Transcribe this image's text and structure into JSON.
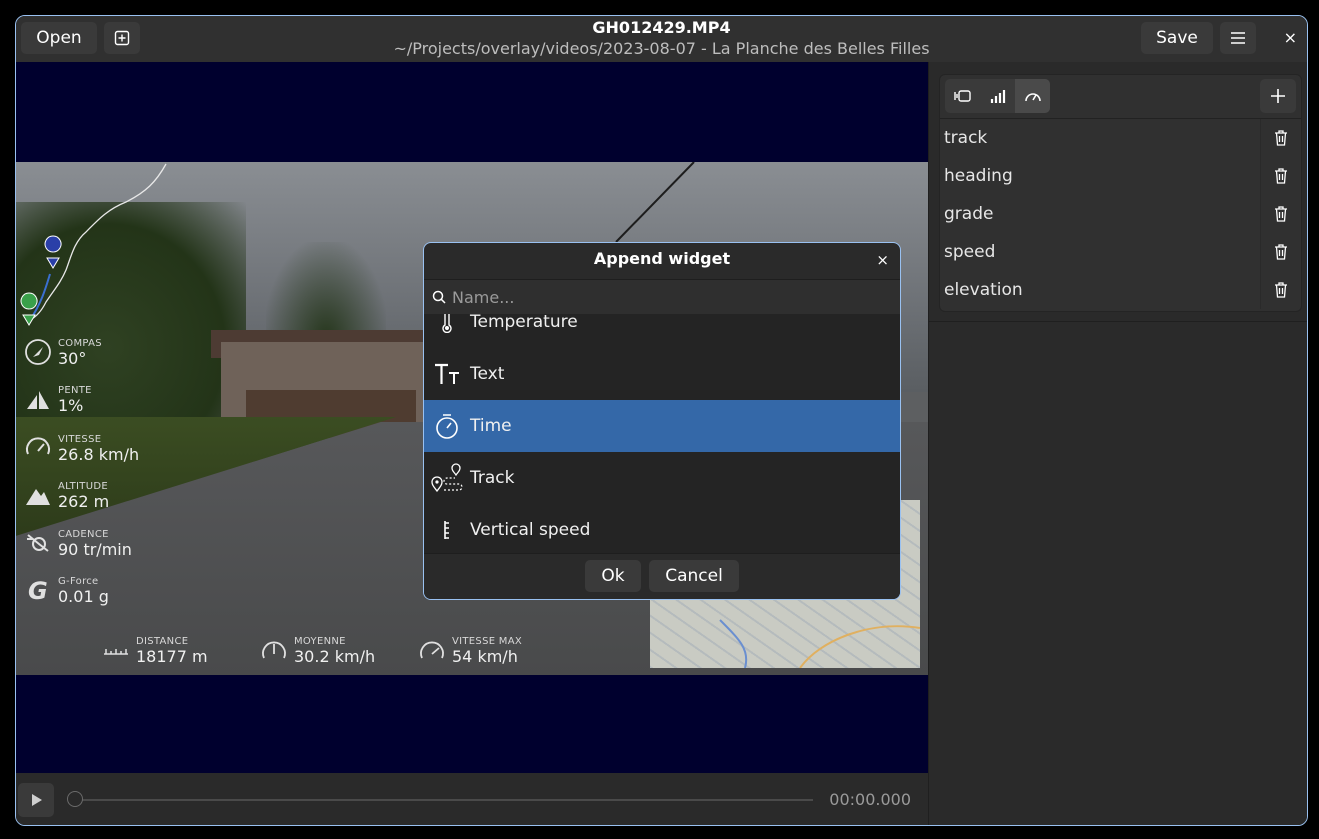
{
  "header": {
    "open_label": "Open",
    "new_icon": "add-square-icon",
    "title": "GH012429.MP4",
    "subtitle": "~/Projects/overlay/videos/2023-08-07 - La Planche des Belles Filles",
    "save_label": "Save",
    "menu_icon": "hamburger-menu-icon",
    "close_glyph": "×"
  },
  "overlay": {
    "items": [
      {
        "label": "COMPAS",
        "value": "30°",
        "icon": "compass-icon"
      },
      {
        "label": "PENTE",
        "value": "1%",
        "icon": "slope-icon"
      },
      {
        "label": "VITESSE",
        "value": "26.8 km/h",
        "icon": "speedometer-icon"
      },
      {
        "label": "ALTITUDE",
        "value": "262 m",
        "icon": "mountain-icon"
      },
      {
        "label": "CADENCE",
        "value": "90 tr/min",
        "icon": "cadence-icon"
      },
      {
        "label": "G-Force",
        "value": "0.01 g",
        "icon": "g-force-icon"
      }
    ],
    "bottom": [
      {
        "label": "DISTANCE",
        "value": "18177 m",
        "icon": "ruler-icon"
      },
      {
        "label": "MOYENNE",
        "value": "30.2 km/h",
        "icon": "average-gauge-icon"
      },
      {
        "label": "VITESSE MAX",
        "value": "54 km/h",
        "icon": "max-gauge-icon"
      }
    ]
  },
  "player": {
    "time": "00:00.000",
    "progress": 0
  },
  "sidebar": {
    "tabs": [
      "video-tab-icon",
      "chart-tab-icon",
      "gauge-tab-icon"
    ],
    "active_tab": 2,
    "widgets": [
      "track",
      "heading",
      "grade",
      "speed",
      "elevation"
    ]
  },
  "dialog": {
    "title": "Append widget",
    "close_glyph": "×",
    "search_placeholder": "Name...",
    "items": [
      {
        "label": "Temperature",
        "icon": "thermometer-icon"
      },
      {
        "label": "Text",
        "icon": "text-icon"
      },
      {
        "label": "Time",
        "icon": "stopwatch-icon",
        "selected": true
      },
      {
        "label": "Track",
        "icon": "track-route-icon"
      },
      {
        "label": "Vertical speed",
        "icon": "vertical-speed-icon"
      }
    ],
    "ok_label": "Ok",
    "cancel_label": "Cancel"
  },
  "colors": {
    "accent": "#99c1f1",
    "selection": "#3468a8",
    "viewer_background": "#00002e"
  }
}
